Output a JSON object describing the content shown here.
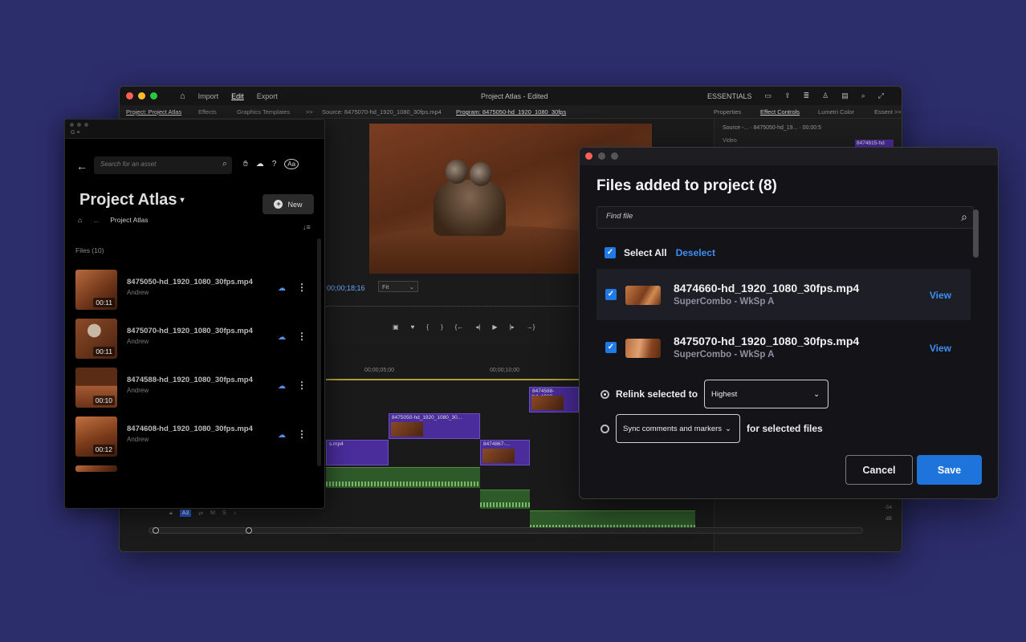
{
  "premiere": {
    "window_title": "Project Atlas - Edited",
    "menu": [
      "Import",
      "Edit",
      "Export"
    ],
    "essentials": "ESSENTIALS",
    "tabs_left": [
      "Project: Project Atlas",
      "Effects",
      "Graphics Templates",
      ">>"
    ],
    "source_tab": "Source: 8475070-hd_1920_1080_30fps.mp4",
    "program_tab": "Program: 8475050-hd_1920_1080_30fps",
    "tabs_right": [
      "Properties",
      "Effect Controls",
      "Lumetri Color",
      "Essent >>"
    ],
    "timecode": "00;00;18;16",
    "fit": "Fit",
    "ruler_times": [
      "00;00;05;00",
      "00;00;10;00"
    ],
    "clips": [
      "8474588-hd_1920_...",
      "8475050-hd_1920_1080_30...",
      "s.mp4",
      "8474867-..."
    ],
    "effect_source": "Source -...",
    "effect_clip_select": "8475050-hd_19...",
    "effect_time": "00:00:5",
    "video_label": "Video",
    "effect_clip": "8474615-hd",
    "db_labels": [
      "-54",
      "dB"
    ],
    "track_label": "A3"
  },
  "frameio": {
    "chrome_label": "G ≡",
    "search_placeholder": "Search for an asset",
    "project_title": "Project Atlas",
    "new_label": "New",
    "breadcrumb": [
      "...",
      "Project Atlas"
    ],
    "files_count": "Files (10)",
    "files": [
      {
        "name": "8475050-hd_1920_1080_30fps.mp4",
        "owner": "Andrew",
        "duration": "00:11"
      },
      {
        "name": "8475070-hd_1920_1080_30fps.mp4",
        "owner": "Andrew",
        "duration": "00:11"
      },
      {
        "name": "8474588-hd_1920_1080_30fps.mp4",
        "owner": "Andrew",
        "duration": "00:10"
      },
      {
        "name": "8474608-hd_1920_1080_30fps.mp4",
        "owner": "Andrew",
        "duration": "00:12"
      }
    ]
  },
  "dialog": {
    "title": "Files added to project (8)",
    "find_placeholder": "Find file",
    "select_all": "Select All",
    "deselect": "Deselect",
    "rows": [
      {
        "name": "8474660-hd_1920_1080_30fps.mp4",
        "sub": "SuperCombo - WkSp A",
        "action": "View",
        "checked": true
      },
      {
        "name": "8475070-hd_1920_1080_30fps.mp4",
        "sub": "SuperCombo - WkSp A",
        "action": "View",
        "checked": true
      }
    ],
    "relink_label": "Relink selected to",
    "relink_value": "Highest",
    "sync_value": "Sync comments and markers",
    "sync_suffix": "for selected files",
    "cancel": "Cancel",
    "save": "Save"
  },
  "colors": {
    "background": "#2c2d6b",
    "accent": "#1f74dc",
    "link": "#3d8ff5",
    "clip": "#4a2c9b"
  }
}
